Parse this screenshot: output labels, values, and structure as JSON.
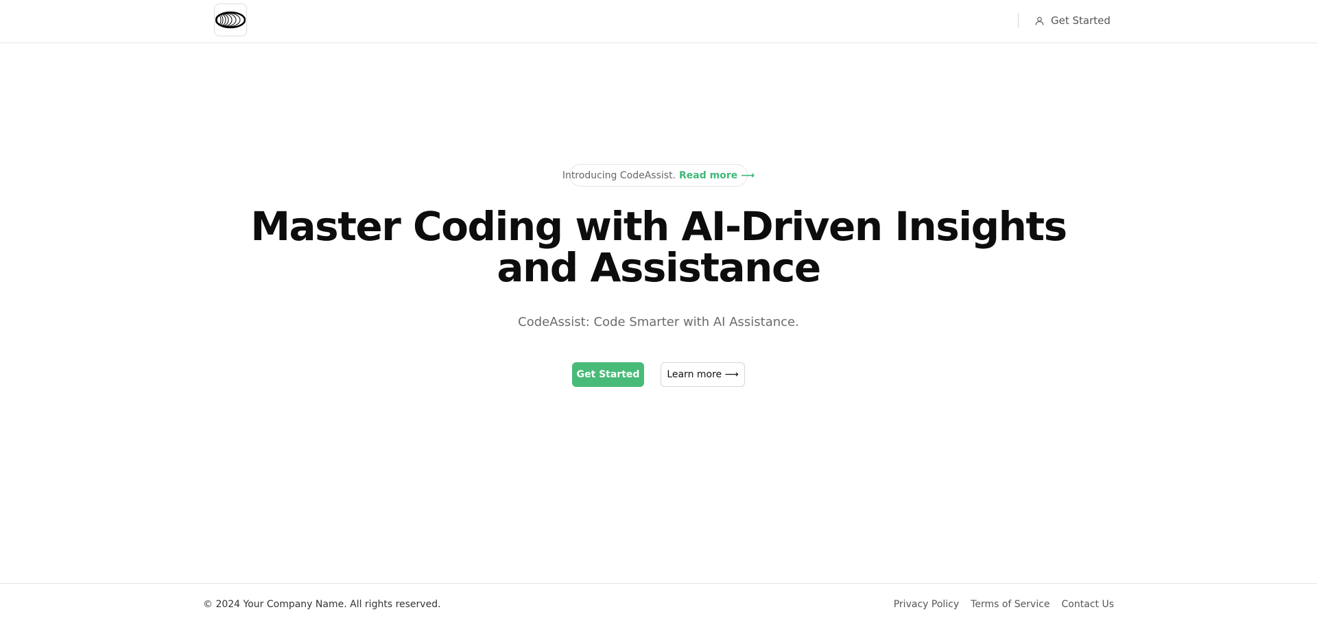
{
  "header": {
    "logo_alt": "logo",
    "cta_label": "Get Started"
  },
  "hero": {
    "badge_text": "Introducing CodeAssist.",
    "badge_link": "Read more ⟶",
    "title_line1": "Master Coding with AI-Driven Insights",
    "title_line2": "and Assistance",
    "subtitle": "CodeAssist: Code Smarter with AI Assistance.",
    "primary_button": "Get Started",
    "secondary_button": "Learn more ⟶"
  },
  "footer": {
    "copyright": "© 2024 Your Company Name. All rights reserved.",
    "links": [
      "Privacy Policy",
      "Terms of Service",
      "Contact Us"
    ]
  },
  "colors": {
    "accent": "#48bb78",
    "accent_text": "#3fb877",
    "border": "#e5e5e5"
  },
  "icons": {
    "logo": "ellipse-rings-logo",
    "cta": "user-icon"
  }
}
